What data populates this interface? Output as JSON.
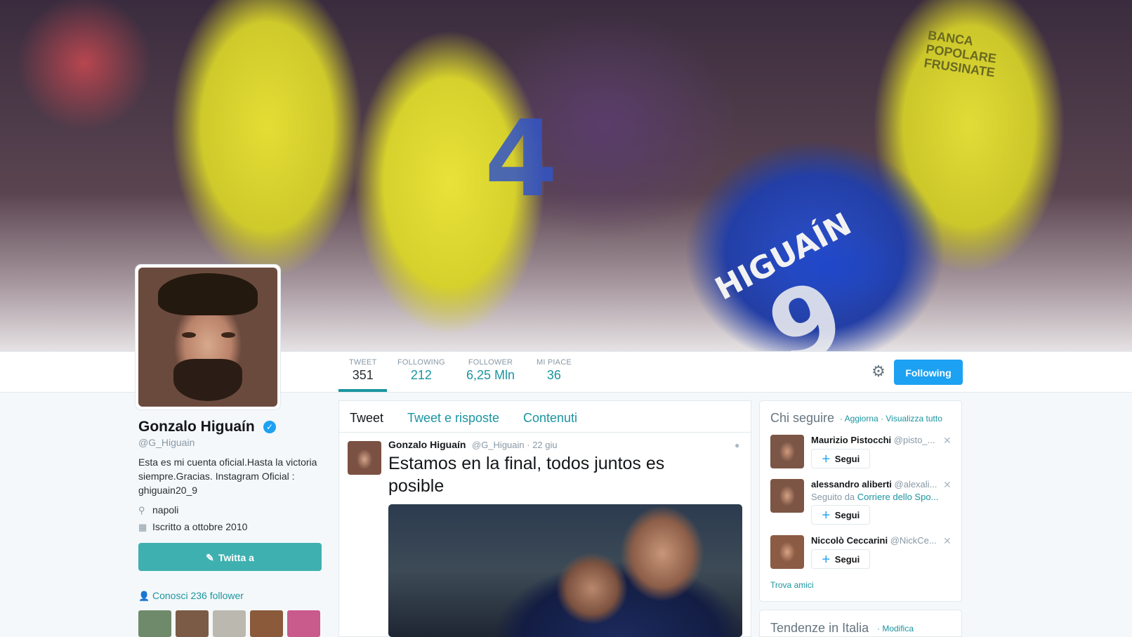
{
  "banner": {
    "player_name": "HIGUAÍN",
    "player_number": "9",
    "opponent_number": "4",
    "sponsor": "BANCA POPOLARE FRUSINATE"
  },
  "nav": {
    "stats": [
      {
        "label": "TWEET",
        "value": "351"
      },
      {
        "label": "FOLLOWING",
        "value": "212"
      },
      {
        "label": "FOLLOWER",
        "value": "6,25 Mln"
      },
      {
        "label": "MI PIACE",
        "value": "36"
      }
    ],
    "follow_button": "Following",
    "gear_icon": "gear-icon"
  },
  "profile": {
    "name": "Gonzalo Higuaín",
    "handle": "@G_Higuain",
    "bio": "Esta es mi cuenta oficial.Hasta la victoria siempre.Gracias. Instagram Oficial : ghiguain20_9",
    "location": "napoli",
    "joined": "Iscritto a ottobre 2010",
    "tweet_to": "Twitta a",
    "know_followers": "Conosci 236 follower",
    "thumb_colors": [
      "#6f8a6a",
      "#7b5b46",
      "#bbb8b0",
      "#8a5a3a",
      "#c85a8c"
    ]
  },
  "timeline": {
    "tabs": [
      "Tweet",
      "Tweet e risposte",
      "Contenuti"
    ],
    "tweet": {
      "author": "Gonzalo Higuaín",
      "handle": "@G_Higuain",
      "time": "· 22 giu",
      "text": "Estamos en la final, todos juntos es posible"
    }
  },
  "who_to_follow": {
    "title": "Chi seguire",
    "refresh": "· Aggiorna",
    "view_all": "· Visualizza tutto",
    "follow_label": "Segui",
    "users": [
      {
        "name": "Maurizio Pistocchi",
        "handle": "@pisto_...",
        "sub_prefix": "",
        "sub_link": ""
      },
      {
        "name": "alessandro aliberti",
        "handle": "@alexali...",
        "sub_prefix": "Seguito da ",
        "sub_link": "Corriere dello Spo..."
      },
      {
        "name": "Niccolò Ceccarini",
        "handle": "@NickCe...",
        "sub_prefix": "",
        "sub_link": ""
      }
    ],
    "find_friends": "Trova amici"
  },
  "trends": {
    "title": "Tendenze in Italia",
    "edit": "· Modifica"
  },
  "colors": {
    "accent": "#1b95a0",
    "follow_blue": "#1da1f2",
    "tweet_to_bg": "#3fb0b0"
  }
}
